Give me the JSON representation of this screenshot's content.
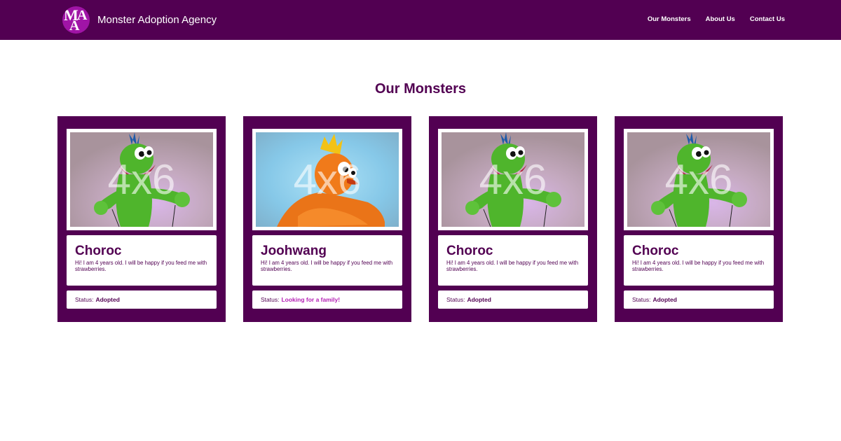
{
  "header": {
    "logo_letters": [
      "M",
      "A",
      "A"
    ],
    "brand_name": "Monster Adoption Agency",
    "nav": [
      {
        "label": "Our Monsters"
      },
      {
        "label": "About Us"
      },
      {
        "label": "Contact Us"
      }
    ]
  },
  "main": {
    "title": "Our Monsters",
    "cards": [
      {
        "photo_text": "4x6",
        "photo_subject": "green-monster",
        "name": "Choroc",
        "description": "Hi! I am 4 years old. I will be happy if you feed me with strawberries.",
        "status_label": "Status:",
        "status_value": "Adopted"
      },
      {
        "photo_text": "4x6",
        "photo_subject": "orange-monster",
        "name": "Joohwang",
        "description": "Hi! I am 4 years old. I will be happy if you feed me with strawberries.",
        "status_label": "Status:",
        "status_value": "Looking for a family!"
      },
      {
        "photo_text": "4x6",
        "photo_subject": "green-monster",
        "name": "Choroc",
        "description": "Hi! I am 4 years old. I will be happy if you feed me with strawberries.",
        "status_label": "Status:",
        "status_value": "Adopted"
      },
      {
        "photo_text": "4x6",
        "photo_subject": "green-monster",
        "name": "Choroc",
        "description": "Hi! I am 4 years old. I will be happy if you feed me with strawberries.",
        "status_label": "Status:",
        "status_value": "Adopted"
      }
    ]
  },
  "colors": {
    "brand_purple": "#520052",
    "logo_magenta": "#a014a6",
    "looking_status": "#b520b5"
  }
}
